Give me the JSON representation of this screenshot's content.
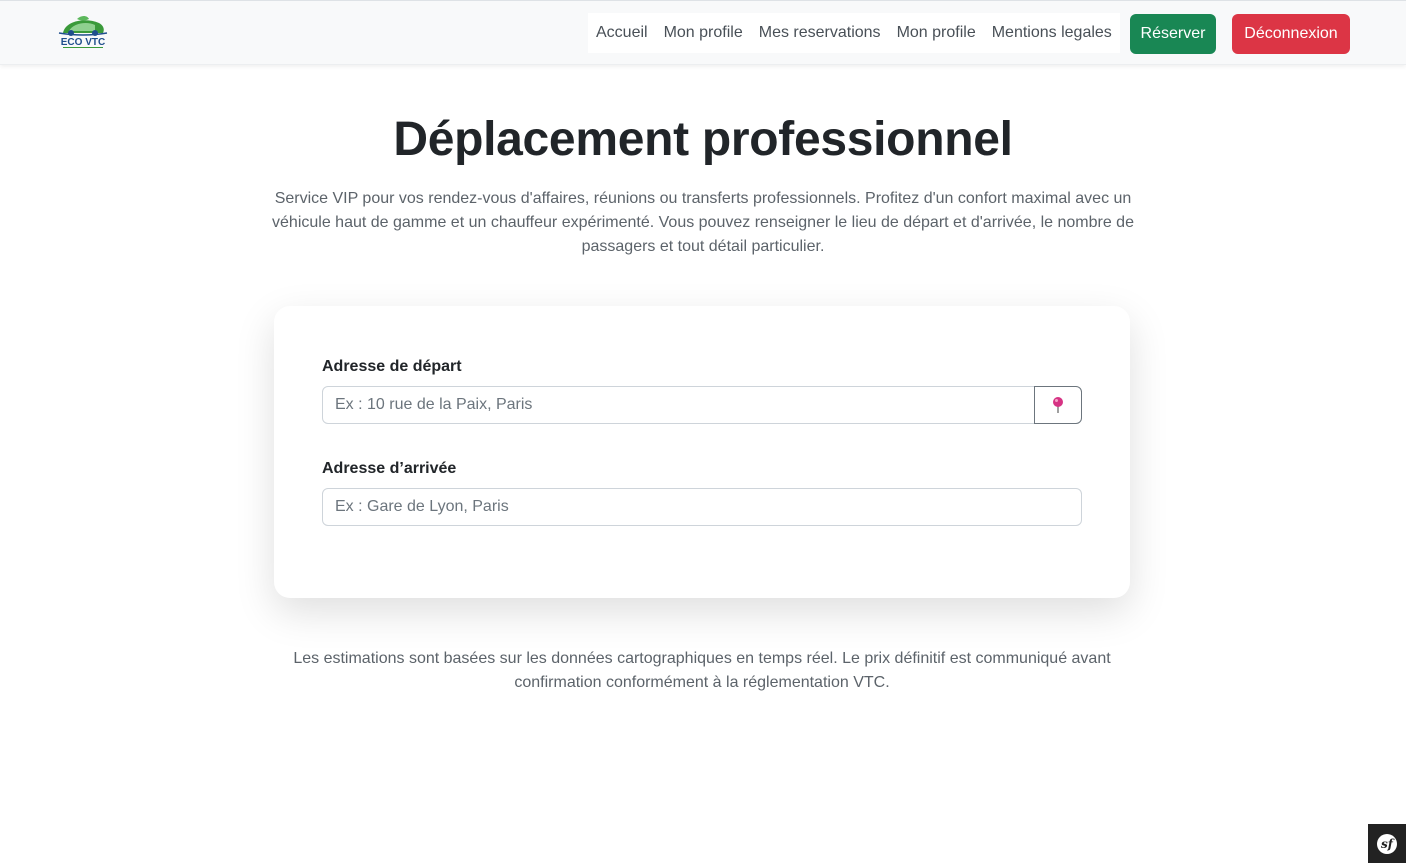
{
  "navbar": {
    "logo_text": "ECO VTC",
    "links": [
      {
        "label": "Accueil"
      },
      {
        "label": "Mon profile"
      },
      {
        "label": "Mes reservations"
      },
      {
        "label": "Mon profile"
      },
      {
        "label": "Mentions legales"
      }
    ],
    "reserver_label": "Réserver",
    "deconnexion_label": "Déconnexion"
  },
  "main": {
    "title": "Déplacement professionnel",
    "description": "Service VIP pour vos rendez-vous d'affaires, réunions ou transferts professionnels. Profitez d'un confort maximal avec un véhicule haut de gamme et un chauffeur expérimenté. Vous pouvez renseigner le lieu de départ et d'arrivée, le nombre de passagers et tout détail particulier."
  },
  "form": {
    "depart_label": "Adresse de départ",
    "depart_placeholder": "Ex : 10 rue de la Paix, Paris",
    "depart_value": "",
    "arrivee_label": "Adresse d’arrivée",
    "arrivee_placeholder": "Ex : Gare de Lyon, Paris",
    "arrivee_value": ""
  },
  "footer_note": "Les estimations sont basées sur les données cartographiques en temps réel. Le prix définitif est communiqué avant confirmation conformément à la réglementation VTC.",
  "debug_toolbar": {
    "icon": "symfony-icon",
    "glyph": "sf"
  },
  "colors": {
    "reserver": "#198754",
    "deconnexion": "#dc3545",
    "pin": "#d63384",
    "logo_green": "#3a9a3a",
    "logo_blue": "#1f4e8c"
  }
}
